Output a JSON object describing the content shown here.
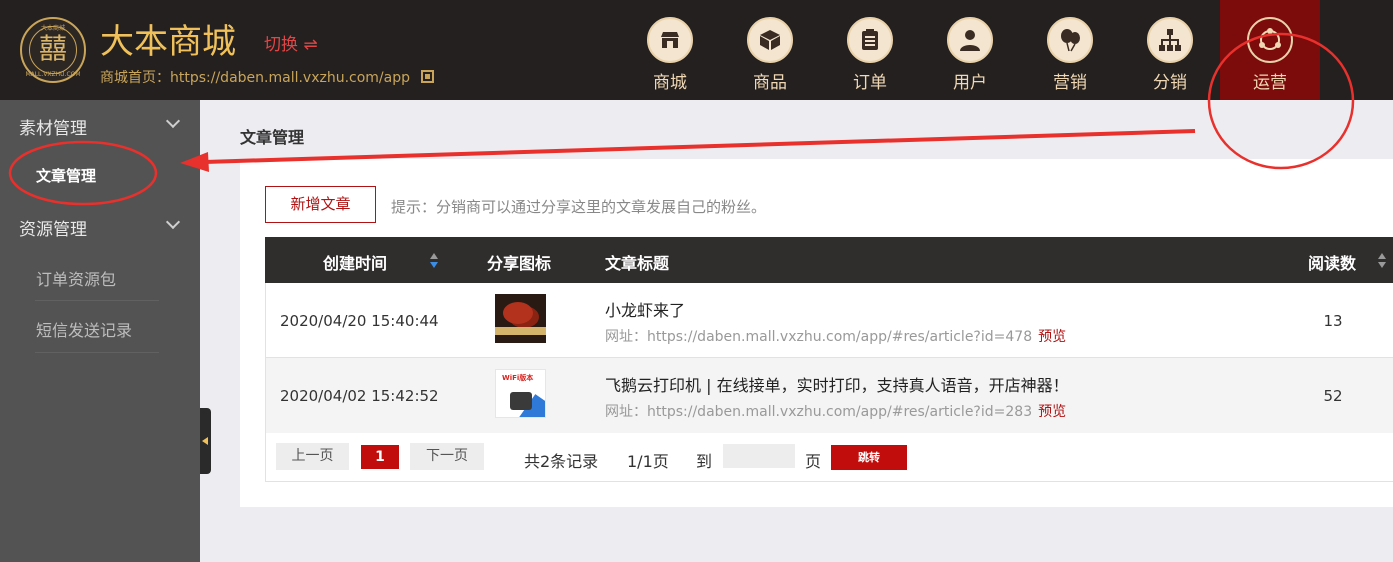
{
  "header": {
    "logo_glyph": "囍",
    "logo_ring_top": "大本商城",
    "logo_ring_bottom": "MALL.VXZHU.COM",
    "brand": "大本商城",
    "switch_label": "切换 ⇌",
    "home_url": "商城首页：https://daben.mall.vxzhu.com/app",
    "nav": [
      {
        "label": "商城",
        "icon": "store-icon"
      },
      {
        "label": "商品",
        "icon": "box-icon"
      },
      {
        "label": "订单",
        "icon": "clipboard-icon"
      },
      {
        "label": "用户",
        "icon": "user-icon"
      },
      {
        "label": "营销",
        "icon": "balloon-icon"
      },
      {
        "label": "分销",
        "icon": "hierarchy-icon"
      },
      {
        "label": "运营",
        "icon": "share-network-icon",
        "active": true
      }
    ]
  },
  "sidebar": {
    "groups": [
      {
        "label": "素材管理",
        "items": [
          {
            "label": "文章管理",
            "active": true
          }
        ]
      },
      {
        "label": "资源管理",
        "items": [
          {
            "label": "订单资源包"
          },
          {
            "label": "短信发送记录"
          }
        ]
      }
    ]
  },
  "main": {
    "page_title": "文章管理",
    "add_button": "新增文章",
    "hint": "提示：分销商可以通过分享这里的文章发展自己的粉丝。",
    "table": {
      "columns": [
        "创建时间",
        "分享图标",
        "文章标题",
        "阅读数"
      ],
      "rows": [
        {
          "created": "2020/04/20 15:40:44",
          "title": "小龙虾来了",
          "url": "网址：https://daben.mall.vxzhu.com/app/#res/article?id=478",
          "preview": "预览",
          "reads": "13"
        },
        {
          "created": "2020/04/02 15:42:52",
          "title": "飞鹅云打印机 | 在线接单，实时打印，支持真人语音，开店神器！",
          "url": "网址：https://daben.mall.vxzhu.com/app/#res/article?id=283",
          "preview": "预览",
          "reads": "52",
          "thumb_tag": "WiFi版本"
        }
      ]
    },
    "pager": {
      "prev": "上一页",
      "current": "1",
      "next": "下一页",
      "total": "共2条记录",
      "pages": "1/1页",
      "goto_prefix": "到",
      "goto_suffix": "页",
      "jump": "跳转"
    }
  },
  "colors": {
    "header_bg": "#24201f",
    "brand_gold": "#f0c15a",
    "active_nav": "#7c0b0b",
    "accent_red": "#c20d0d",
    "sidebar_bg": "#535353",
    "annotation_red": "#e8302c"
  }
}
